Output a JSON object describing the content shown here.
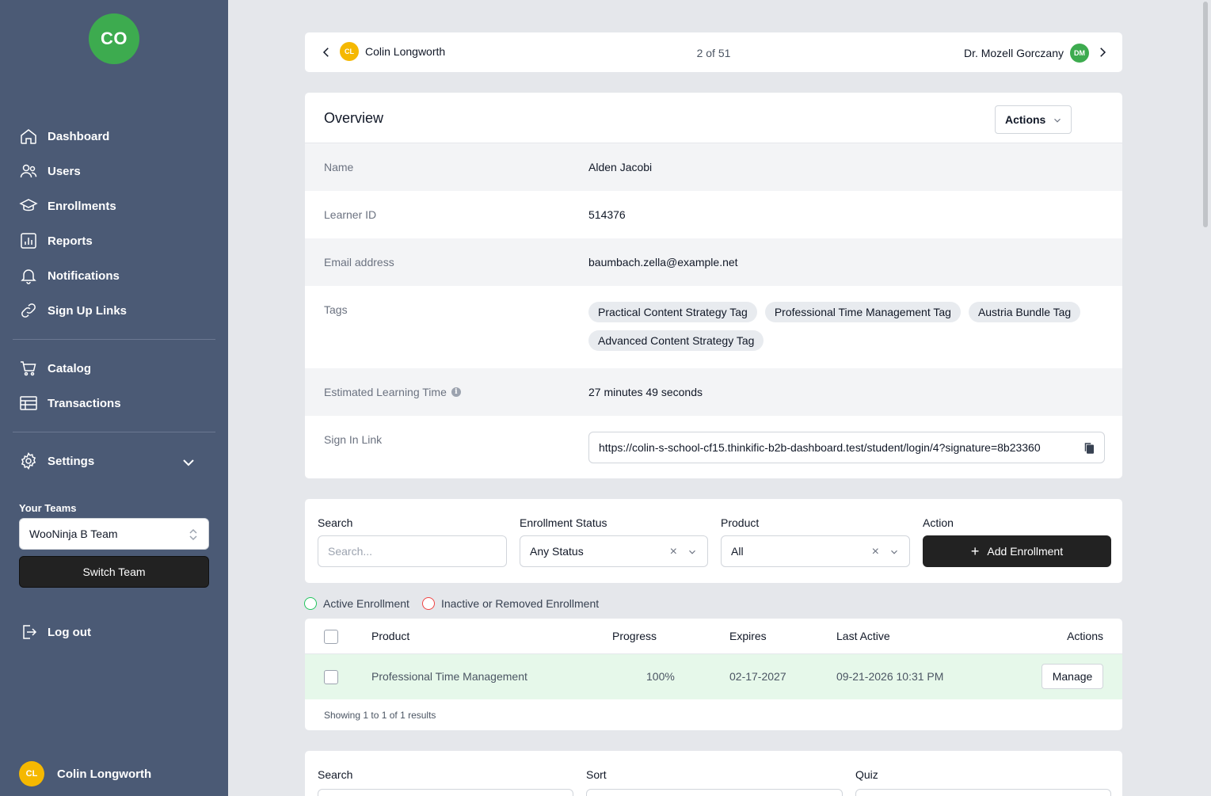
{
  "sidebar": {
    "logo_text": "CO",
    "nav": [
      {
        "label": "Dashboard",
        "icon": "home-icon"
      },
      {
        "label": "Users",
        "icon": "users-icon"
      },
      {
        "label": "Enrollments",
        "icon": "graduation-cap-icon"
      },
      {
        "label": "Reports",
        "icon": "bar-chart-icon"
      },
      {
        "label": "Notifications",
        "icon": "bell-icon"
      },
      {
        "label": "Sign Up Links",
        "icon": "link-icon"
      }
    ],
    "nav2": [
      {
        "label": "Catalog",
        "icon": "cart-icon"
      },
      {
        "label": "Transactions",
        "icon": "table-icon"
      }
    ],
    "settings_label": "Settings",
    "teams_label": "Your Teams",
    "team_selected": "WooNinja B Team",
    "switch_team_label": "Switch Team",
    "logout_label": "Log out",
    "user": {
      "initials": "CL",
      "name": "Colin Longworth"
    }
  },
  "topnav": {
    "prev_user": {
      "initials": "CL",
      "name": "Colin Longworth"
    },
    "counter": "2 of 51",
    "next_user": {
      "initials": "DM",
      "name": "Dr. Mozell Gorczany"
    }
  },
  "overview": {
    "title": "Overview",
    "actions_label": "Actions",
    "name_label": "Name",
    "name_value": "Alden Jacobi",
    "learner_id_label": "Learner ID",
    "learner_id_value": "514376",
    "email_label": "Email address",
    "email_value": "baumbach.zella@example.net",
    "tags_label": "Tags",
    "tags": [
      "Practical Content Strategy Tag",
      "Professional Time Management Tag",
      "Austria Bundle Tag",
      "Advanced Content Strategy Tag"
    ],
    "elt_label": "Estimated Learning Time",
    "elt_value": "27 minutes 49 seconds",
    "signin_label": "Sign In Link",
    "signin_value": "https://colin-s-school-cf15.thinkific-b2b-dashboard.test/student/login/4?signature=8b23360"
  },
  "filters": {
    "search_label": "Search",
    "search_placeholder": "Search...",
    "status_label": "Enrollment Status",
    "status_value": "Any Status",
    "product_label": "Product",
    "product_value": "All",
    "action_label": "Action",
    "add_label": "Add Enrollment"
  },
  "legend": {
    "active": "Active Enrollment",
    "inactive": "Inactive or Removed Enrollment"
  },
  "table": {
    "headers": {
      "product": "Product",
      "progress": "Progress",
      "expires": "Expires",
      "last_active": "Last Active",
      "actions": "Actions"
    },
    "rows": [
      {
        "product": "Professional Time Management",
        "progress": "100%",
        "expires": "02-17-2027",
        "last_active": "09-21-2026 10:31 PM",
        "action": "Manage"
      }
    ],
    "footer": "Showing 1 to 1 of 1 results"
  },
  "quiz_filters": {
    "search_label": "Search",
    "sort_label": "Sort",
    "quiz_label": "Quiz"
  },
  "colors": {
    "sidebar": "#4b5a75",
    "logo": "#3dab4f",
    "avatar_cl": "#f5b800",
    "avatar_dm": "#3dab4f",
    "active_row": "#e6f8ea"
  }
}
